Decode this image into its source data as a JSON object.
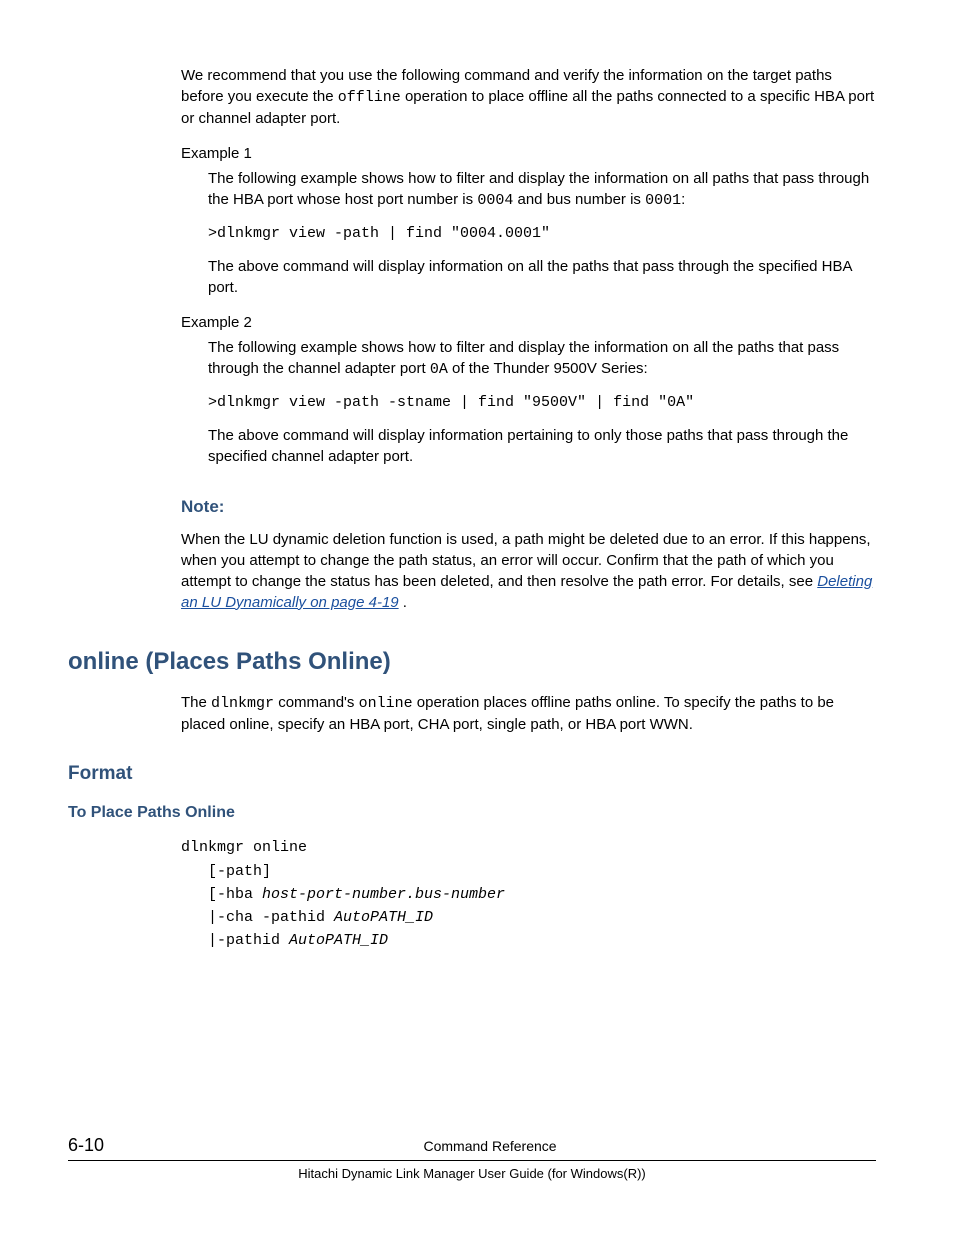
{
  "intro": {
    "p1a": "We recommend that you use the following command and verify the information on the target paths before you execute the ",
    "p1code": "offline",
    "p1b": " operation to place offline all the paths connected to a specific HBA port or channel adapter port."
  },
  "example1": {
    "label": "Example 1",
    "body1a": "The following example shows how to filter and display the information on all paths that pass through the HBA port whose host port number is ",
    "body1code1": "0004",
    "body1b": " and bus number is ",
    "body1code2": "0001",
    "body1c": ":",
    "cmd": ">dlnkmgr view -path | find \"0004.0001\"",
    "body2": "The above command will display information on all the paths that pass through the specified HBA port."
  },
  "example2": {
    "label": "Example 2",
    "body1a": "The following example shows how to filter and display the information on all the paths that pass through the channel adapter port ",
    "body1code1": "0A",
    "body1b": " of the Thunder 9500V Series:",
    "cmd": ">dlnkmgr view -path -stname | find \"9500V\" | find \"0A\"",
    "body2": "The above command will display information pertaining to only those paths that pass through the specified channel adapter port."
  },
  "note": {
    "heading": "Note:",
    "body": "When the LU dynamic deletion function is used, a path might be deleted due to an error. If this happens, when you attempt to change the path status, an error will occur. Confirm that the path of which you attempt to change the status has been deleted, and then resolve the path error. For details, see ",
    "link": "Deleting an LU Dynamically on page 4-19",
    "tail": " ."
  },
  "online": {
    "heading": "online (Places Paths Online)",
    "p1a": "The ",
    "p1code1": "dlnkmgr",
    "p1b": " command's ",
    "p1code2": "online",
    "p1c": " operation places offline paths online. To specify the paths to be placed online, specify an HBA port, CHA port, single path, or HBA port WWN."
  },
  "format": {
    "heading": "Format",
    "sub": "To Place Paths Online",
    "line1": "dlnkmgr online",
    "line2": "   [-path]",
    "line3a": "   [-hba ",
    "line3b": "host-port-number.bus-number",
    "line4a": "   |-cha -pathid ",
    "line4b": "AutoPATH_ID",
    "line5a": "   |-pathid ",
    "line5b": "AutoPATH_ID"
  },
  "footer": {
    "page": "6-10",
    "chapter": "Command Reference",
    "doc": "Hitachi Dynamic Link Manager User Guide (for Windows(R))"
  }
}
